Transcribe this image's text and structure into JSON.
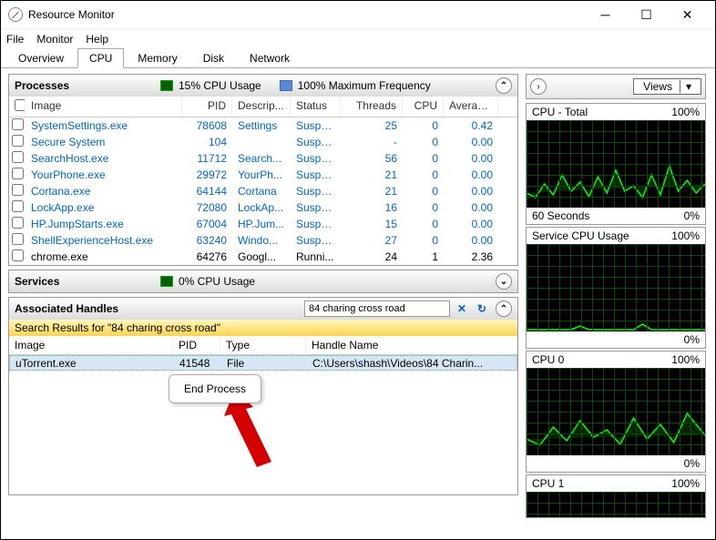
{
  "window": {
    "title": "Resource Monitor"
  },
  "menu": {
    "file": "File",
    "monitor": "Monitor",
    "help": "Help"
  },
  "tabs": {
    "overview": "Overview",
    "cpu": "CPU",
    "memory": "Memory",
    "disk": "Disk",
    "network": "Network"
  },
  "processes": {
    "title": "Processes",
    "usage": "15% CPU Usage",
    "freq": "100% Maximum Frequency",
    "cols": {
      "image": "Image",
      "pid": "PID",
      "desc": "Descrip...",
      "status": "Status",
      "threads": "Threads",
      "cpu": "CPU",
      "avg": "Averag..."
    },
    "rows": [
      {
        "image": "SystemSettings.exe",
        "pid": "78608",
        "desc": "Settings",
        "status": "Suspe...",
        "threads": "25",
        "cpu": "0",
        "avg": "0.42",
        "sus": true
      },
      {
        "image": "Secure System",
        "pid": "104",
        "desc": "",
        "status": "Suspe...",
        "threads": "-",
        "cpu": "0",
        "avg": "0.00",
        "sus": true
      },
      {
        "image": "SearchHost.exe",
        "pid": "11712",
        "desc": "Search...",
        "status": "Suspe...",
        "threads": "56",
        "cpu": "0",
        "avg": "0.00",
        "sus": true
      },
      {
        "image": "YourPhone.exe",
        "pid": "29972",
        "desc": "YourPh...",
        "status": "Suspe...",
        "threads": "21",
        "cpu": "0",
        "avg": "0.00",
        "sus": true
      },
      {
        "image": "Cortana.exe",
        "pid": "64144",
        "desc": "Cortana",
        "status": "Suspe...",
        "threads": "21",
        "cpu": "0",
        "avg": "0.00",
        "sus": true
      },
      {
        "image": "LockApp.exe",
        "pid": "72080",
        "desc": "LockAp...",
        "status": "Suspe...",
        "threads": "16",
        "cpu": "0",
        "avg": "0.00",
        "sus": true
      },
      {
        "image": "HP.JumpStarts.exe",
        "pid": "67004",
        "desc": "HP.Jum...",
        "status": "Suspe...",
        "threads": "15",
        "cpu": "0",
        "avg": "0.00",
        "sus": true
      },
      {
        "image": "ShellExperienceHost.exe",
        "pid": "63240",
        "desc": "Windo...",
        "status": "Suspe...",
        "threads": "27",
        "cpu": "0",
        "avg": "0.00",
        "sus": true
      },
      {
        "image": "chrome.exe",
        "pid": "64276",
        "desc": "Googl...",
        "status": "Runni...",
        "threads": "24",
        "cpu": "1",
        "avg": "2.36",
        "sus": false
      }
    ]
  },
  "services": {
    "title": "Services",
    "usage": "0% CPU Usage"
  },
  "handles": {
    "title": "Associated Handles",
    "search_value": "84 charing cross road",
    "results_label": "Search Results for \"84 charing cross road\"",
    "cols": {
      "image": "Image",
      "pid": "PID",
      "type": "Type",
      "name": "Handle Name"
    },
    "row": {
      "image": "uTorrent.exe",
      "pid": "41548",
      "type": "File",
      "name": "C:\\Users\\shash\\Videos\\84 Charin..."
    }
  },
  "ctx": {
    "end": "End Process"
  },
  "right": {
    "views": "Views",
    "g1": {
      "title": "CPU - Total",
      "pct": "100%",
      "foot_l": "60 Seconds",
      "foot_r": "0%"
    },
    "g2": {
      "title": "Service CPU Usage",
      "pct": "100%",
      "foot_r": "0%"
    },
    "g3": {
      "title": "CPU 0",
      "pct": "100%",
      "foot_r": "0%"
    },
    "g4": {
      "title": "CPU 1",
      "pct": "100%"
    }
  }
}
